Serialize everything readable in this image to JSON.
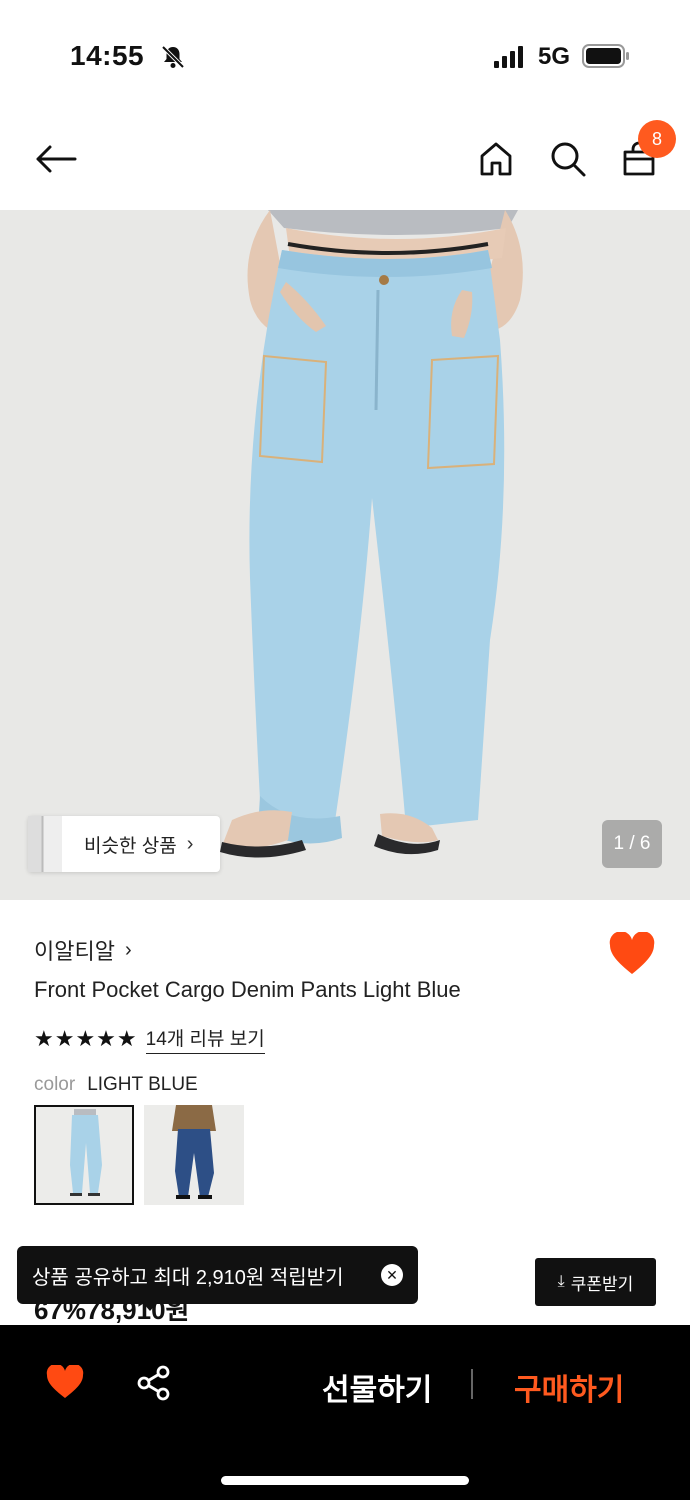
{
  "status_bar": {
    "time": "14:55",
    "network": "5G",
    "icons": [
      "bell-slash-icon",
      "signal-icon",
      "battery-icon"
    ]
  },
  "top_nav": {
    "icons": [
      "back-arrow-icon",
      "home-icon",
      "search-icon",
      "shopping-bag-icon"
    ],
    "cart_count": "8"
  },
  "hero": {
    "similar_label": "비슷한 상품",
    "similar_chevron": "›",
    "page_indicator": "1 / 6"
  },
  "product": {
    "brand": "이알티알",
    "brand_chevron": "›",
    "name": "Front Pocket Cargo Denim Pants Light Blue",
    "stars": "★★★★★",
    "review_link": "14개 리뷰 보기",
    "color_key": "color",
    "color_value": "LIGHT BLUE",
    "price_peek": "67%78,910원",
    "swatches": [
      {
        "name": "light-blue-swatch",
        "selected": true
      },
      {
        "name": "dark-blue-swatch",
        "selected": false
      }
    ]
  },
  "share_toast": {
    "label": "상품 공유하고 최대 2,910원 적립받기",
    "close": "✕"
  },
  "coupon": {
    "icon": "⤓",
    "label": "쿠폰받기"
  },
  "bottom_bar": {
    "gift_label": "선물하기",
    "buy_label": "구매하기"
  },
  "colors": {
    "accent": "#ff5a1f",
    "wish": "#ff4a12",
    "bar": "#000000"
  }
}
